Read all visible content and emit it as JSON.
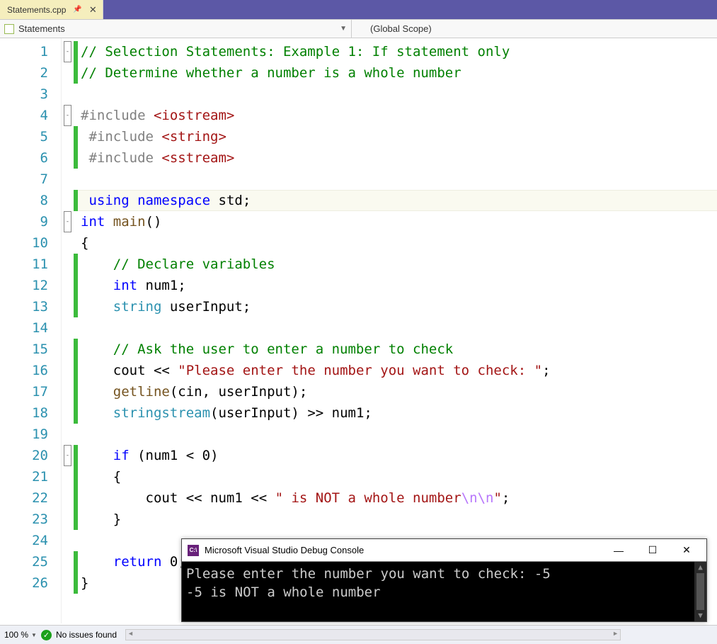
{
  "tab": {
    "filename": "Statements.cpp"
  },
  "nav": {
    "left": "Statements",
    "right": "(Global Scope)"
  },
  "lineCount": 26,
  "folds": {
    "1": "-",
    "4": "-",
    "9": "-",
    "20": "-"
  },
  "changed": [
    1,
    2,
    5,
    6,
    8,
    11,
    12,
    13,
    15,
    16,
    17,
    18,
    20,
    21,
    22,
    23,
    25,
    26
  ],
  "currentLine": 8,
  "code": [
    [
      [
        "comment",
        "// Selection Statements: Example 1: If statement only"
      ]
    ],
    [
      [
        "comment",
        "// Determine whether a number is a whole number"
      ]
    ],
    [],
    [
      [
        "ppkw",
        "#include "
      ],
      [
        "string",
        "<iostream>"
      ]
    ],
    [
      [
        "plain",
        " "
      ],
      [
        "ppkw",
        "#include "
      ],
      [
        "string",
        "<string>"
      ]
    ],
    [
      [
        "plain",
        " "
      ],
      [
        "ppkw",
        "#include "
      ],
      [
        "string",
        "<sstream>"
      ]
    ],
    [],
    [
      [
        "plain",
        " "
      ],
      [
        "keyword",
        "using"
      ],
      [
        "plain",
        " "
      ],
      [
        "keyword",
        "namespace"
      ],
      [
        "plain",
        " std;"
      ]
    ],
    [
      [
        "keyword",
        "int"
      ],
      [
        "plain",
        " "
      ],
      [
        "func",
        "main"
      ],
      [
        "plain",
        "()"
      ]
    ],
    [
      [
        "plain",
        "{"
      ]
    ],
    [
      [
        "plain",
        "    "
      ],
      [
        "comment",
        "// Declare variables"
      ]
    ],
    [
      [
        "plain",
        "    "
      ],
      [
        "keyword",
        "int"
      ],
      [
        "plain",
        " num1;"
      ]
    ],
    [
      [
        "plain",
        "    "
      ],
      [
        "type",
        "string"
      ],
      [
        "plain",
        " userInput;"
      ]
    ],
    [],
    [
      [
        "plain",
        "    "
      ],
      [
        "comment",
        "// Ask the user to enter a number to check"
      ]
    ],
    [
      [
        "plain",
        "    cout "
      ],
      [
        "op",
        "<<"
      ],
      [
        "plain",
        " "
      ],
      [
        "string",
        "\"Please enter the number you want to check: \""
      ],
      [
        "plain",
        ";"
      ]
    ],
    [
      [
        "plain",
        "    "
      ],
      [
        "func",
        "getline"
      ],
      [
        "plain",
        "(cin, userInput);"
      ]
    ],
    [
      [
        "plain",
        "    "
      ],
      [
        "type",
        "stringstream"
      ],
      [
        "plain",
        "(userInput) "
      ],
      [
        "op",
        ">>"
      ],
      [
        "plain",
        " num1;"
      ]
    ],
    [],
    [
      [
        "plain",
        "    "
      ],
      [
        "keyword",
        "if"
      ],
      [
        "plain",
        " (num1 "
      ],
      [
        "op",
        "<"
      ],
      [
        "plain",
        " "
      ],
      [
        "num",
        "0"
      ],
      [
        "plain",
        ")"
      ]
    ],
    [
      [
        "plain",
        "    {"
      ]
    ],
    [
      [
        "plain",
        "        cout "
      ],
      [
        "op",
        "<<"
      ],
      [
        "plain",
        " num1 "
      ],
      [
        "op",
        "<<"
      ],
      [
        "plain",
        " "
      ],
      [
        "string",
        "\" is NOT a whole number"
      ],
      [
        "escape",
        "\\n\\n"
      ],
      [
        "string",
        "\""
      ],
      [
        "plain",
        ";"
      ]
    ],
    [
      [
        "plain",
        "    }"
      ]
    ],
    [],
    [
      [
        "plain",
        "    "
      ],
      [
        "keyword",
        "return"
      ],
      [
        "plain",
        " "
      ],
      [
        "num",
        "0"
      ],
      [
        "plain",
        ";"
      ]
    ],
    [
      [
        "plain",
        "}"
      ]
    ]
  ],
  "console": {
    "title": "Microsoft Visual Studio Debug Console",
    "lines": [
      "Please enter the number you want to check: -5",
      "-5 is NOT a whole number"
    ]
  },
  "status": {
    "zoom": "100 %",
    "issues": "No issues found"
  }
}
